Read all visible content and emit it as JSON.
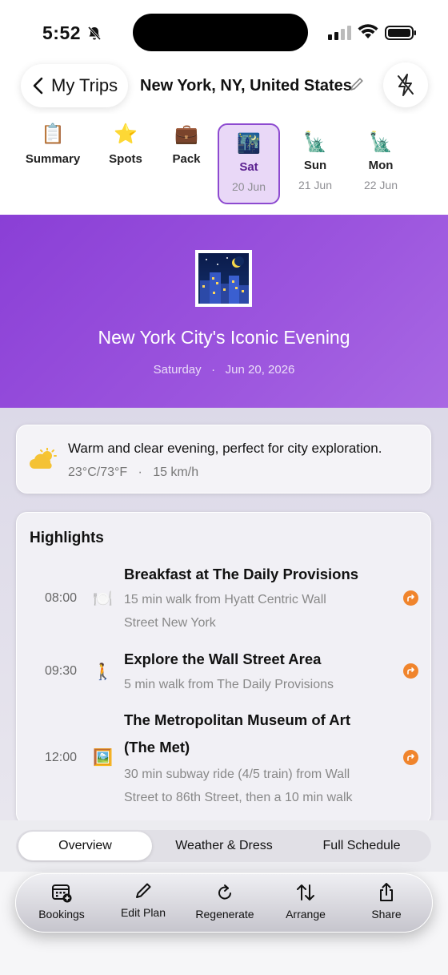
{
  "status": {
    "time": "5:52"
  },
  "header": {
    "back_label": "My Trips",
    "trip_title": "New York, NY, United States"
  },
  "tabs": [
    {
      "emoji": "📋",
      "label": "Summary",
      "sub": ""
    },
    {
      "emoji": "⭐",
      "label": "Spots",
      "sub": ""
    },
    {
      "emoji": "💼",
      "label": "Pack",
      "sub": ""
    },
    {
      "emoji": "🌃",
      "label": "Sat",
      "sub": "20 Jun"
    },
    {
      "emoji": "🗽",
      "label": "Sun",
      "sub": "21 Jun"
    },
    {
      "emoji": "🗽",
      "label": "Mon",
      "sub": "22 Jun"
    }
  ],
  "hero": {
    "title": "New York City's Iconic Evening",
    "day": "Saturday",
    "date": "Jun 20, 2026"
  },
  "weather": {
    "summary": "Warm and clear evening, perfect for city exploration.",
    "temp": "23°C/73°F",
    "wind": "15 km/h"
  },
  "highlights": {
    "title": "Highlights",
    "items": [
      {
        "time": "08:00",
        "icon": "🍽️",
        "name": "Breakfast at The Daily Provisions",
        "desc_lines": [
          "15 min walk from Hyatt Centric Wall",
          "Street New York"
        ]
      },
      {
        "time": "09:30",
        "icon": "🚶",
        "name": "Explore the Wall Street Area",
        "desc_lines": [
          "5 min walk from The Daily Provisions"
        ]
      },
      {
        "time": "12:00",
        "icon": "🖼️",
        "name_lines": [
          "The Metropolitan Museum of Art",
          "(The Met)"
        ],
        "desc_lines": [
          "30 min subway ride (4/5 train) from Wall",
          "Street to 86th Street, then a 10 min walk"
        ]
      }
    ]
  },
  "segments": [
    "Overview",
    "Weather & Dress",
    "Full Schedule"
  ],
  "toolbar": {
    "bookings": "Bookings",
    "edit_plan": "Edit Plan",
    "regenerate": "Regenerate",
    "arrange": "Arrange",
    "share": "Share"
  },
  "colors": {
    "accent": "#8a3fd6",
    "arrow": "#f0842c"
  }
}
